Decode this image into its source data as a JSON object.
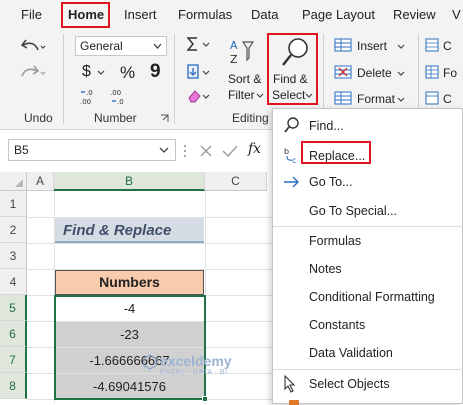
{
  "menubar": {
    "tabs": [
      "File",
      "Home",
      "Insert",
      "Formulas",
      "Data",
      "Page Layout",
      "Review",
      "V"
    ]
  },
  "ribbon": {
    "undo_group_label": "Undo",
    "number_group_label": "Number",
    "number_format_value": "General",
    "currency_symbol": "$",
    "percent_symbol": "%",
    "comma_symbol": "9",
    "sort_filter_label_1": "Sort &",
    "sort_filter_label_2": "Filter",
    "find_select_label_1": "Find &",
    "find_select_label_2": "Select",
    "editing_group_label": "Editing",
    "insert_label": "Insert",
    "delete_label": "Delete",
    "format_label": "Format",
    "cells_c1": "C",
    "cells_c2": "Fo",
    "cells_c3": "C"
  },
  "formula_bar": {
    "name_box": "B5",
    "fx": "fx"
  },
  "grid": {
    "columns": [
      "A",
      "B",
      "C"
    ],
    "rows": [
      "1",
      "2",
      "3",
      "4",
      "5",
      "6",
      "7",
      "8"
    ],
    "title": "Find & Replace",
    "header": "Numbers",
    "values": [
      "-4",
      "-23",
      "-1.666666667",
      "-4.69041576"
    ]
  },
  "find_menu": {
    "items": [
      "Find...",
      "Replace...",
      "Go To...",
      "Go To Special...",
      "Formulas",
      "Notes",
      "Conditional Formatting",
      "Constants",
      "Data Validation",
      "Select Objects"
    ]
  },
  "watermark": {
    "name": "exceldemy",
    "tagline": "EXCEL · DATA · BI"
  },
  "colors": {
    "highlight_red": "#e0141e",
    "header_fill": "#f8cbad",
    "title_fill": "#d6dce4",
    "gray_fill": "#d0d0d0",
    "selection_green": "#217346"
  }
}
